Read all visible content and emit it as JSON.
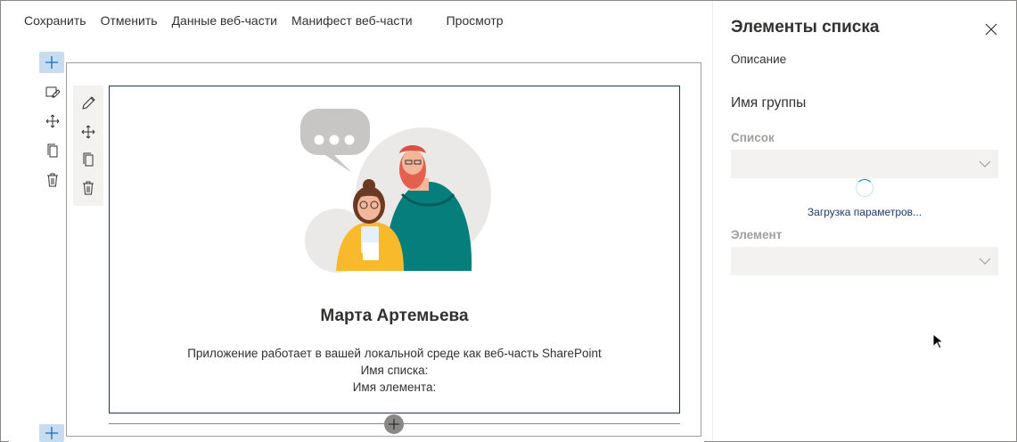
{
  "toolbar": {
    "save": "Сохранить",
    "cancel": "Отменить",
    "webpart_data": "Данные веб-части",
    "webpart_manifest": "Манифест веб-части",
    "preview": "Просмотр"
  },
  "webpart": {
    "title": "Марта Артемьева",
    "line1": "Приложение работает в вашей локальной среде как веб-часть SharePoint",
    "line2": "Имя списка:",
    "line3": "Имя элемента:"
  },
  "pane": {
    "title": "Элементы списка",
    "description": "Описание",
    "group_name": "Имя группы",
    "list_label": "Список",
    "list_value": "",
    "loading": "Загрузка параметров...",
    "item_label": "Элемент",
    "item_value": ""
  },
  "icons": {
    "add": "plus-icon",
    "edit": "pencil-icon",
    "move": "move-icon",
    "duplicate": "copy-icon",
    "delete": "trash-icon",
    "close": "close-icon",
    "dropdown": "chevron-down-icon",
    "loading": "spinner-icon",
    "cursor": "mouse-pointer-icon"
  },
  "colors": {
    "accent": "#0078d4",
    "add_button_bg": "#c7dcf0",
    "webpart_border": "#1b3a5c",
    "disabled_label": "#a19f9d",
    "dropdown_bg": "#f3f2f1"
  }
}
